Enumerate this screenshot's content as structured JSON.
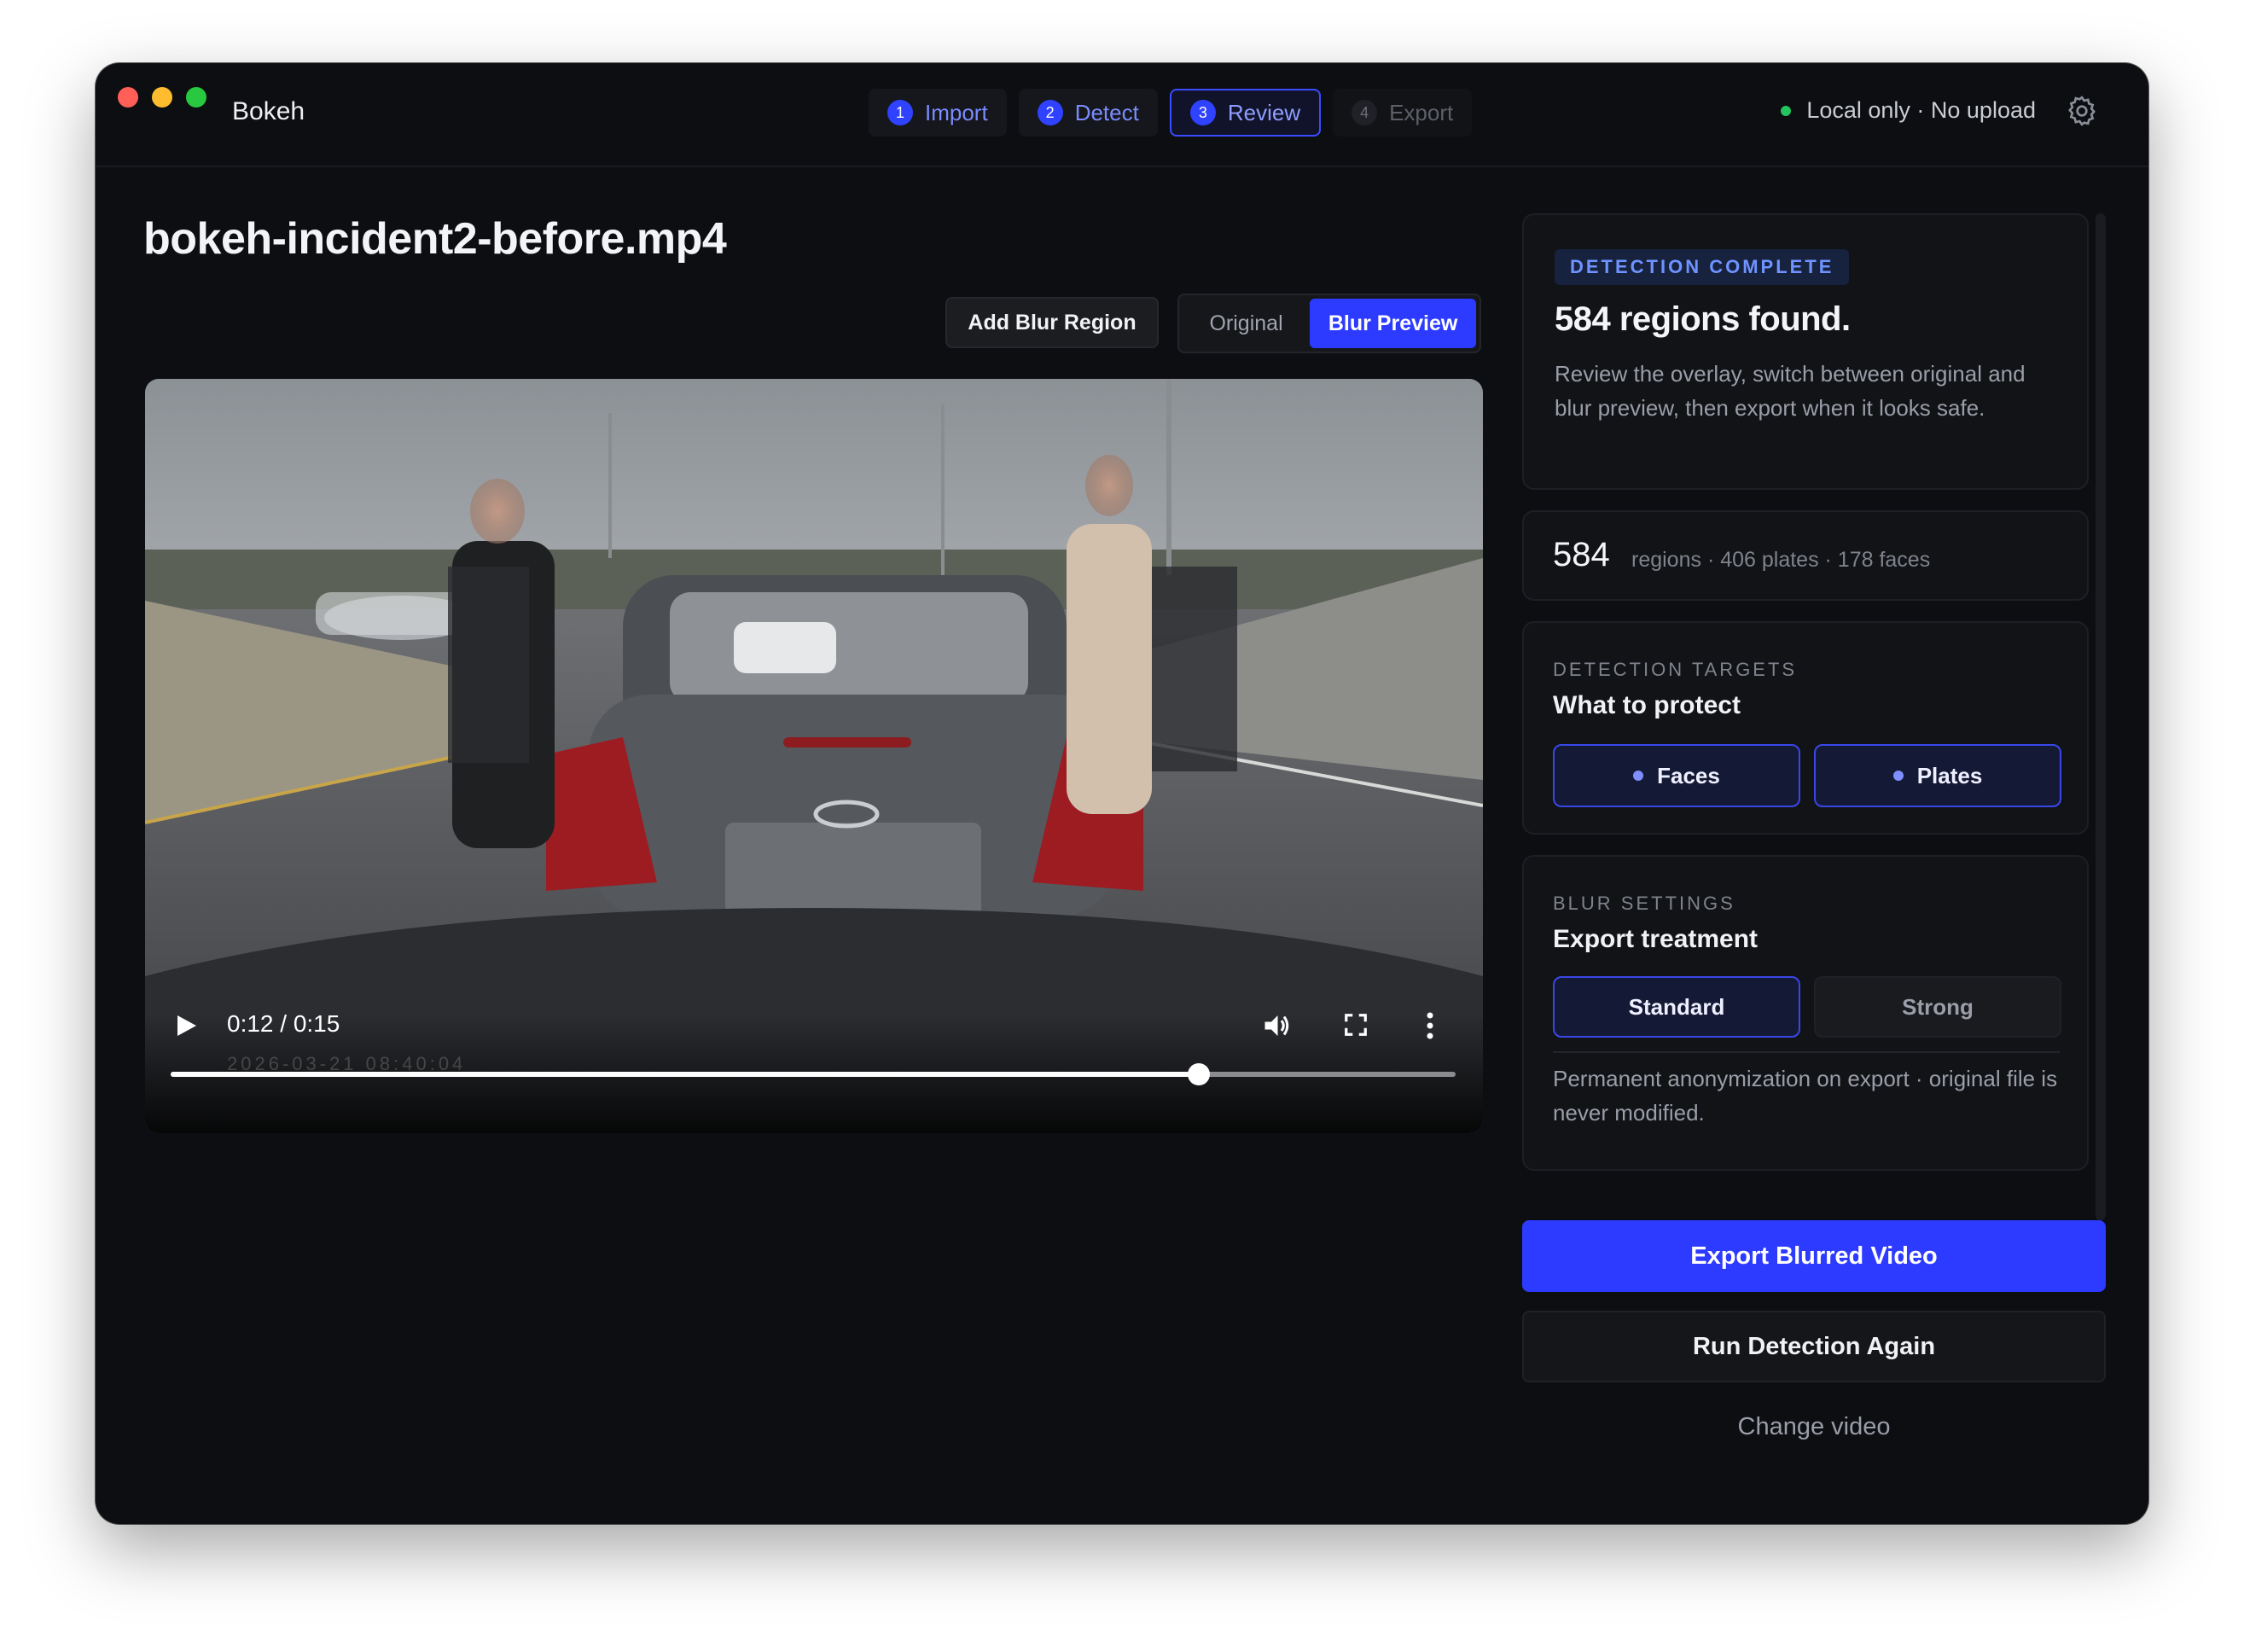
{
  "app": {
    "title": "Bokeh"
  },
  "steps": [
    {
      "num": "1",
      "label": "Import"
    },
    {
      "num": "2",
      "label": "Detect"
    },
    {
      "num": "3",
      "label": "Review"
    },
    {
      "num": "4",
      "label": "Export"
    }
  ],
  "status": {
    "text": "Local only · No upload",
    "color": "#22c55e"
  },
  "file": {
    "name": "bokeh-incident2-before.mp4"
  },
  "toolbar": {
    "add_blur": "Add Blur Region",
    "view_original": "Original",
    "view_blur": "Blur Preview"
  },
  "player": {
    "time": "0:12 / 0:15",
    "progress": 0.8,
    "watermark": "2026-03-21 08:40:04"
  },
  "summary": {
    "badge": "DETECTION COMPLETE",
    "headline": "584 regions found.",
    "description": "Review the overlay, switch between original and blur preview, then export when it looks safe."
  },
  "counts": {
    "total": "584",
    "breakdown": "regions · 406 plates · 178 faces"
  },
  "targets": {
    "caption": "DETECTION TARGETS",
    "heading": "What to protect",
    "options": [
      {
        "label": "Faces",
        "selected": true
      },
      {
        "label": "Plates",
        "selected": true
      }
    ]
  },
  "blur": {
    "caption": "BLUR SETTINGS",
    "heading": "Export treatment",
    "options": [
      {
        "label": "Standard",
        "selected": true
      },
      {
        "label": "Strong",
        "selected": false
      }
    ],
    "note": "Permanent anonymization on export · original file is never modified."
  },
  "actions": {
    "export": "Export Blurred Video",
    "rerun": "Run Detection Again",
    "change": "Change video"
  },
  "colors": {
    "accent": "#2c3bff",
    "background": "#0d0e11"
  }
}
